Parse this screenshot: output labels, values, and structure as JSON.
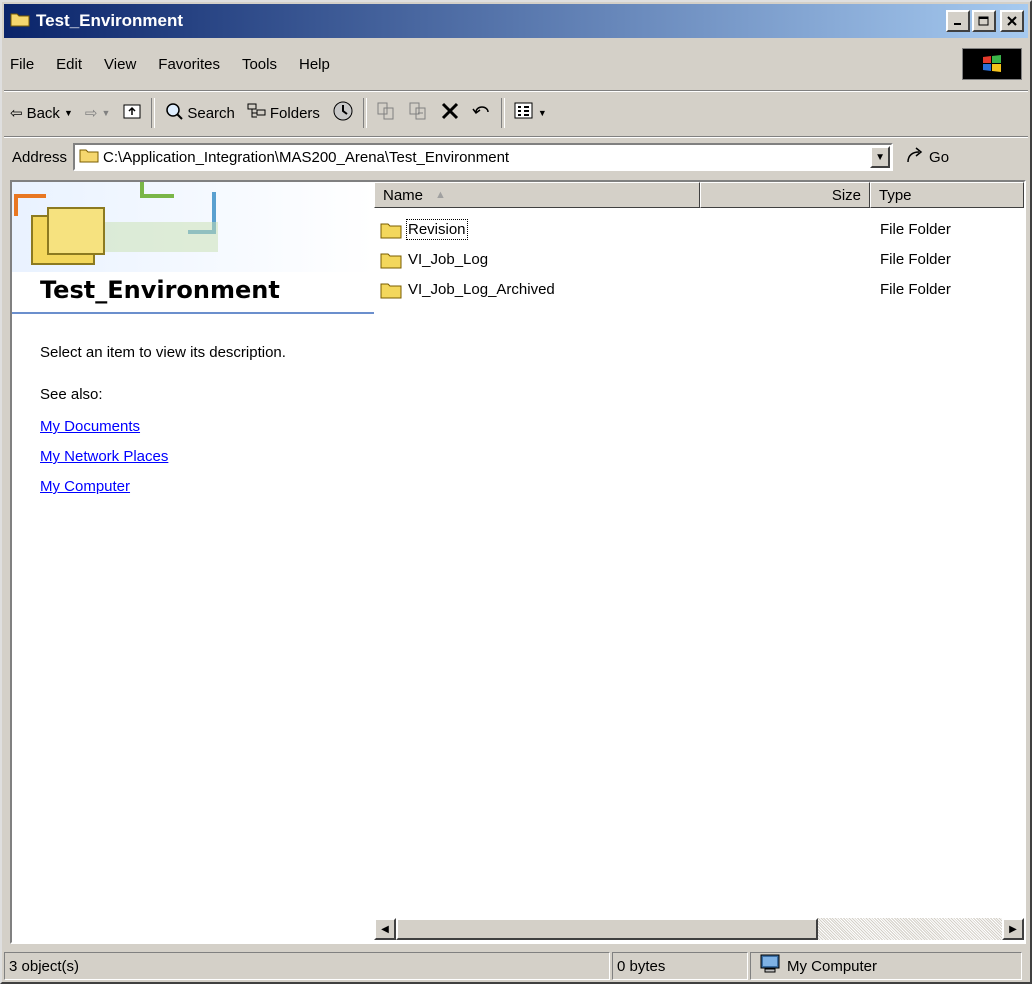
{
  "window": {
    "title": "Test_Environment"
  },
  "menu": [
    "File",
    "Edit",
    "View",
    "Favorites",
    "Tools",
    "Help"
  ],
  "toolbar": {
    "back_label": "Back",
    "search_label": "Search",
    "folders_label": "Folders"
  },
  "address": {
    "label": "Address",
    "value": "C:\\Application_Integration\\MAS200_Arena\\Test_Environment",
    "go_label": "Go"
  },
  "left_pane": {
    "folder_title": "Test_Environment",
    "description": "Select an item to view its description.",
    "see_also_label": "See also:",
    "links": [
      "My Documents",
      "My Network Places",
      "My Computer"
    ]
  },
  "file_list": {
    "columns": [
      "Name",
      "Size",
      "Type"
    ],
    "rows": [
      {
        "name": "Revision",
        "size": "",
        "type": "File Folder"
      },
      {
        "name": "VI_Job_Log",
        "size": "",
        "type": "File Folder"
      },
      {
        "name": "VI_Job_Log_Archived",
        "size": "",
        "type": "File Folder"
      }
    ]
  },
  "status": {
    "objects": "3 object(s)",
    "bytes": "0 bytes",
    "zone": "My Computer"
  },
  "colors": {
    "title_gradient_start": "#0a246a",
    "title_gradient_end": "#a6caf0",
    "link": "#0000ff",
    "face": "#d4d0c8"
  }
}
